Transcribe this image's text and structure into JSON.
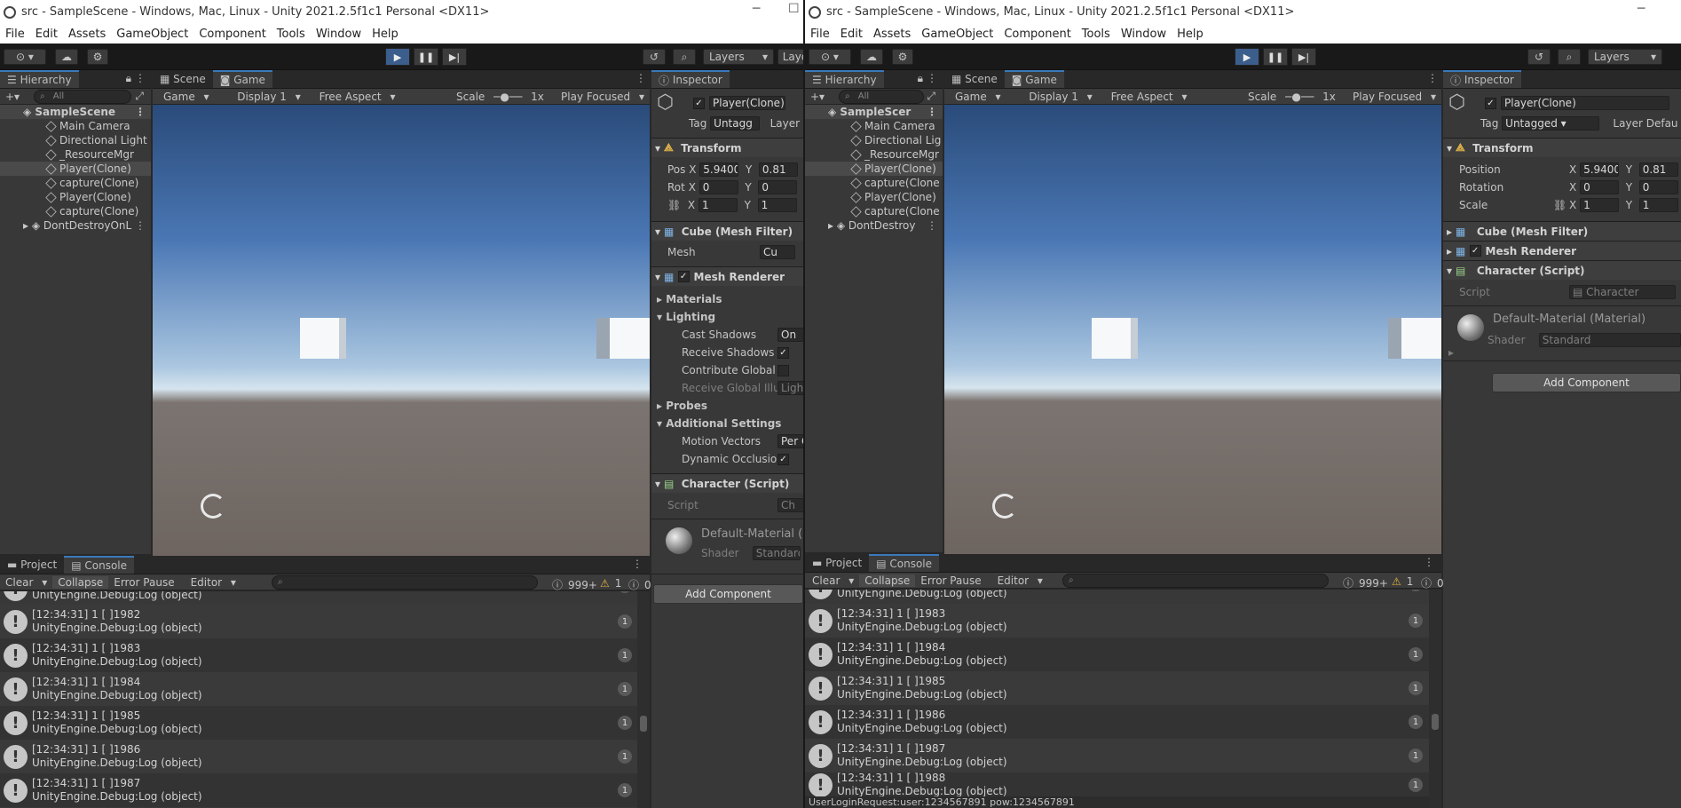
{
  "title": "src - SampleScene - Windows, Mac, Linux - Unity 2021.2.5f1c1 Personal <DX11>",
  "menu": [
    "File",
    "Edit",
    "Assets",
    "GameObject",
    "Component",
    "Tools",
    "Window",
    "Help"
  ],
  "toolbar": {
    "layers": "Layers",
    "layout": "Layo"
  },
  "hierarchy": {
    "tab": "Hierarchy",
    "search": "All",
    "scene": "SampleScene",
    "scene_short": "SampleScer",
    "items": [
      "Main Camera",
      "Directional Light",
      "_ResourceMgr",
      "Player(Clone)",
      "capture(Clone)",
      "Player(Clone)",
      "capture(Clone)"
    ],
    "items_short": [
      "Main Camera",
      "Directional Lig",
      "_ResourceMgr",
      "Player(Clone)",
      "capture(Clone",
      "Player(Clone)",
      "capture(Clone"
    ],
    "ddol": "DontDestroyOnL",
    "ddol_short": "DontDestroy"
  },
  "scene_tab": "Scene",
  "game_tab": "Game",
  "game_bar": {
    "mode": "Game",
    "display": "Display 1",
    "aspect": "Free Aspect",
    "scale": "Scale",
    "scale_val": "1x",
    "play": "Play Focused"
  },
  "inspector": {
    "tab": "Inspector",
    "object": "Player(Clone)",
    "tag_label": "Tag",
    "tag_short": "Untagg",
    "tag": "Untagged",
    "layer_short": "Layer",
    "layer": "Layer",
    "layer_val": "Defau",
    "transform": "Transform",
    "pos_short": "Pos",
    "rot_short": "Rot",
    "position": "Position",
    "rotation": "Rotation",
    "scale": "Scale",
    "x": "X",
    "y": "Y",
    "pos_x": "5.9400",
    "pos_y": "0.81",
    "rot_x": "0",
    "rot_y": "0",
    "sc_x": "1",
    "sc_y": "1",
    "mesh_filter": "Cube (Mesh Filter)",
    "mesh_label": "Mesh",
    "mesh_val": "Cu",
    "mesh_renderer": "Mesh Renderer",
    "materials": "Materials",
    "lighting": "Lighting",
    "cast": "Cast Shadows",
    "cast_val": "On",
    "receive": "Receive Shadows",
    "contribute": "Contribute Global I",
    "receive_gi": "Receive Global Illu",
    "receive_gi_val": "Light",
    "probes": "Probes",
    "additional": "Additional Settings",
    "motion": "Motion Vectors",
    "motion_val": "Per O",
    "dynamic": "Dynamic Occlusio",
    "character": "Character (Script)",
    "script": "Script",
    "script_short": "Ch",
    "script_val": "Character",
    "material": "Default-Material (Material)",
    "material_short": "Default-Material (M",
    "shader": "Shader",
    "shader_val": "Standard",
    "add_component": "Add Component"
  },
  "console": {
    "project_tab": "Project",
    "console_tab": "Console",
    "clear": "Clear",
    "collapse": "Collapse",
    "error_pause": "Error Pause",
    "editor": "Editor",
    "count_log": "999+",
    "count_warn": "1",
    "count_err": "0",
    "stack": "UnityEngine.Debug:Log (object)",
    "left_entries": [
      "[12:34:31] 1         [ ]1982",
      "[12:34:31] 1         [ ]1983",
      "[12:34:31] 1         [ ]1984",
      "[12:34:31] 1         [ ]1985",
      "[12:34:31] 1         [ ]1986",
      "[12:34:31] 1         [ ]1987"
    ],
    "right_entries": [
      "[12:34:31] 1         [ ]1983",
      "[12:34:31] 1         [ ]1984",
      "[12:34:31] 1         [ ]1985",
      "[12:34:31] 1         [ ]1986",
      "[12:34:31] 1         [ ]1987",
      "[12:34:31] 1         [ ]1988"
    ],
    "entry_count": "1",
    "status": "UserLoginRequest:user:1234567891 pow:1234567891"
  }
}
